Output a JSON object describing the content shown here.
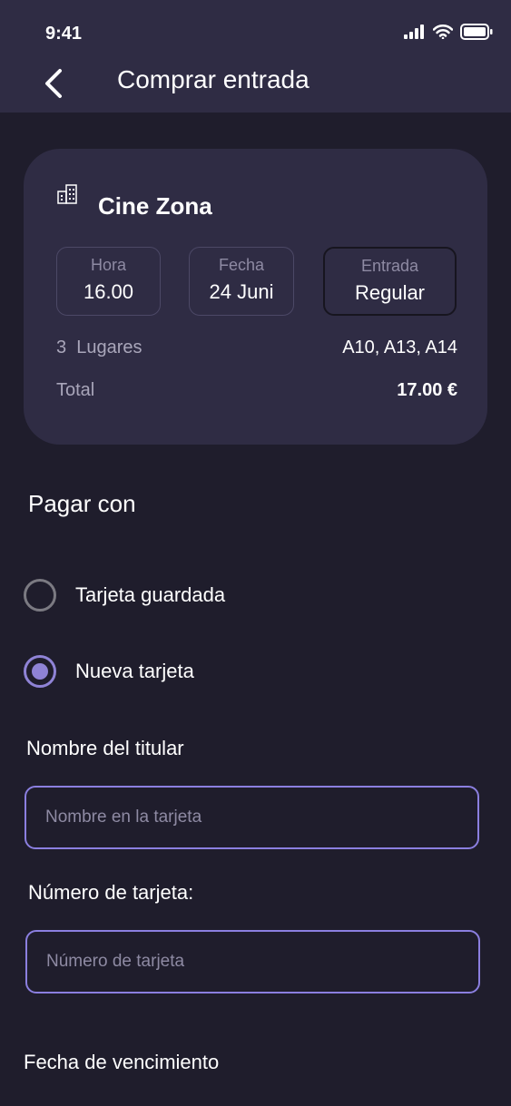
{
  "status": {
    "time": "9:41"
  },
  "header": {
    "title": "Comprar entrada"
  },
  "ticket": {
    "cinema": "Cine Zona",
    "hora_label": "Hora",
    "hora_value": "16.00",
    "fecha_label": "Fecha",
    "fecha_value": "24 Juni",
    "entrada_label": "Entrada",
    "entrada_value": "Regular",
    "seats_label": "3  Lugares",
    "seats_value": "A10, A13, A14",
    "total_label": "Total",
    "total_value": "17.00 €"
  },
  "payment": {
    "title": "Pagar con",
    "options": [
      {
        "label": "Tarjeta guardada",
        "selected": false
      },
      {
        "label": "Nueva tarjeta",
        "selected": true
      }
    ]
  },
  "form": {
    "name_label": "Nombre del titular",
    "name_placeholder": "Nombre en la tarjeta",
    "number_label": "Número de tarjeta:",
    "number_placeholder": "Número de tarjeta",
    "expiry_label": "Fecha de vencimiento"
  },
  "colors": {
    "accent": "#8f83d6",
    "background": "#1f1d2c",
    "card": "#2f2c44"
  }
}
